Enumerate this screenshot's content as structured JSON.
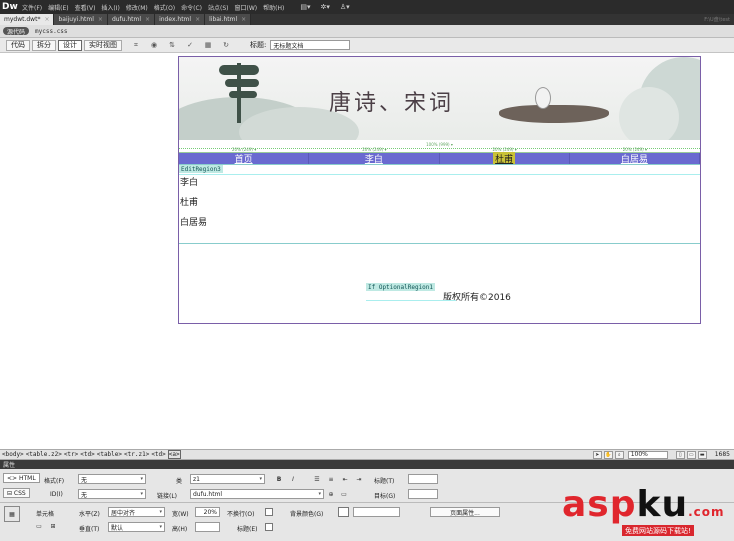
{
  "app": {
    "logo": "Dw"
  },
  "menu": [
    "文件(F)",
    "编辑(E)",
    "查看(V)",
    "插入(I)",
    "修改(M)",
    "格式(O)",
    "命令(C)",
    "站点(S)",
    "窗口(W)",
    "帮助(H)"
  ],
  "menu_right": [
    "▤▾",
    "✲▾",
    "♙▾"
  ],
  "tabs": [
    {
      "label": "mydwt.dwt*",
      "active": true
    },
    {
      "label": "baijuyi.html",
      "active": false
    },
    {
      "label": "dufu.html",
      "active": false
    },
    {
      "label": "index.html",
      "active": false
    },
    {
      "label": "libai.html",
      "active": false
    }
  ],
  "tab_path": "F:\\U盘\\test",
  "related": {
    "source_label": "源代码",
    "file": "mycss.css"
  },
  "doc_toolbar": {
    "code": "代码",
    "split": "拆分",
    "design": "设计",
    "live": "实时视图",
    "title_label": "标题:",
    "title_value": "无标题文档"
  },
  "page": {
    "banner_title": "唐诗、宋词",
    "hint_total": "100% (999) ▾",
    "hint_cells": [
      "20% (249) ▾",
      "20% (249) ▾",
      "20% (249) ▾",
      "20% (249) ▾"
    ],
    "nav": [
      {
        "label": "首页",
        "current": false
      },
      {
        "label": "李白",
        "current": false
      },
      {
        "label": "杜甫",
        "current": true
      },
      {
        "label": "白居易",
        "current": false
      }
    ],
    "edit_region_tag": "EditRegion3",
    "poets": [
      "李白",
      "杜甫",
      "白居易"
    ],
    "optional_tag": "If OptionalRegion1",
    "footer": "版权所有©2016"
  },
  "tag_selector": [
    "<body>",
    "<table.z2>",
    "<tr>",
    "<td>",
    "<table>",
    "<tr.z1>",
    "<td>",
    "<a>"
  ],
  "status": {
    "zoom": "100%",
    "size": "1685"
  },
  "properties": {
    "header": "属性",
    "html_btn": "<> HTML",
    "css_btn": "⊟ CSS",
    "format_label": "格式(F)",
    "format_value": "无",
    "class_label": "类",
    "class_value": "z1",
    "bold": "B",
    "italic": "I",
    "title_label": "标题(T)",
    "id_label": "ID(I)",
    "id_value": "无",
    "link_label": "链接(L)",
    "link_value": "dufu.html",
    "target_label": "目标(G)",
    "cell_label": "单元格",
    "horz_label": "水平(Z)",
    "horz_value": "居中对齐",
    "width_label": "宽(W)",
    "width_value": "20%",
    "nowrap_label": "不换行(O)",
    "bg_label": "背景颜色(G)",
    "page_props": "页面属性...",
    "vert_label": "垂直(T)",
    "vert_value": "默认",
    "height_label": "高(H)",
    "header_label": "标题(E)"
  },
  "watermark": {
    "asp": "asp",
    "ku": "ku",
    "dot": ".com",
    "sub": "免费网站源码下载站!"
  }
}
